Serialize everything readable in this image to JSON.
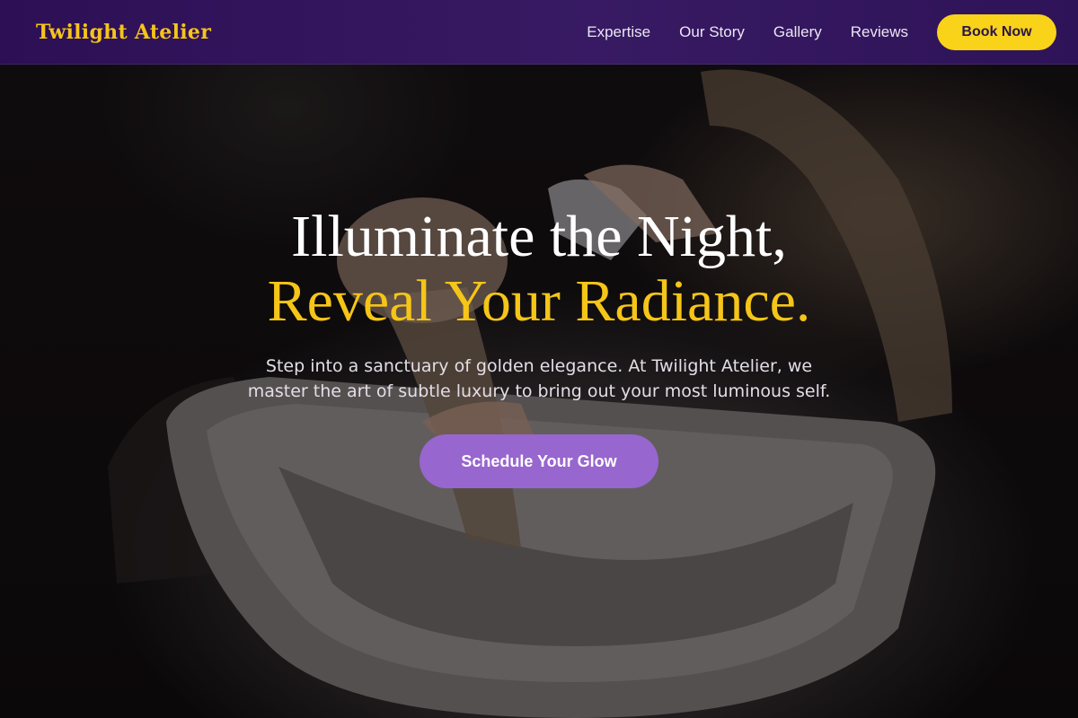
{
  "header": {
    "brand": "Twilight Atelier",
    "nav": [
      {
        "label": "Expertise"
      },
      {
        "label": "Our Story"
      },
      {
        "label": "Gallery"
      },
      {
        "label": "Reviews"
      }
    ],
    "cta_label": "Book Now"
  },
  "hero": {
    "title_line1": "Illuminate the Night,",
    "title_line2": "Reveal Your Radiance.",
    "subtitle": "Step into a sanctuary of golden elegance. At Twilight Atelier, we master the art of subtle luxury to bring out your most luminous self.",
    "cta_label": "Schedule Your Glow"
  },
  "colors": {
    "header_bg": "#2d0f55",
    "brand_gold": "#f5c518",
    "book_button": "#f9d21a",
    "cta_button": "#9866cf"
  }
}
